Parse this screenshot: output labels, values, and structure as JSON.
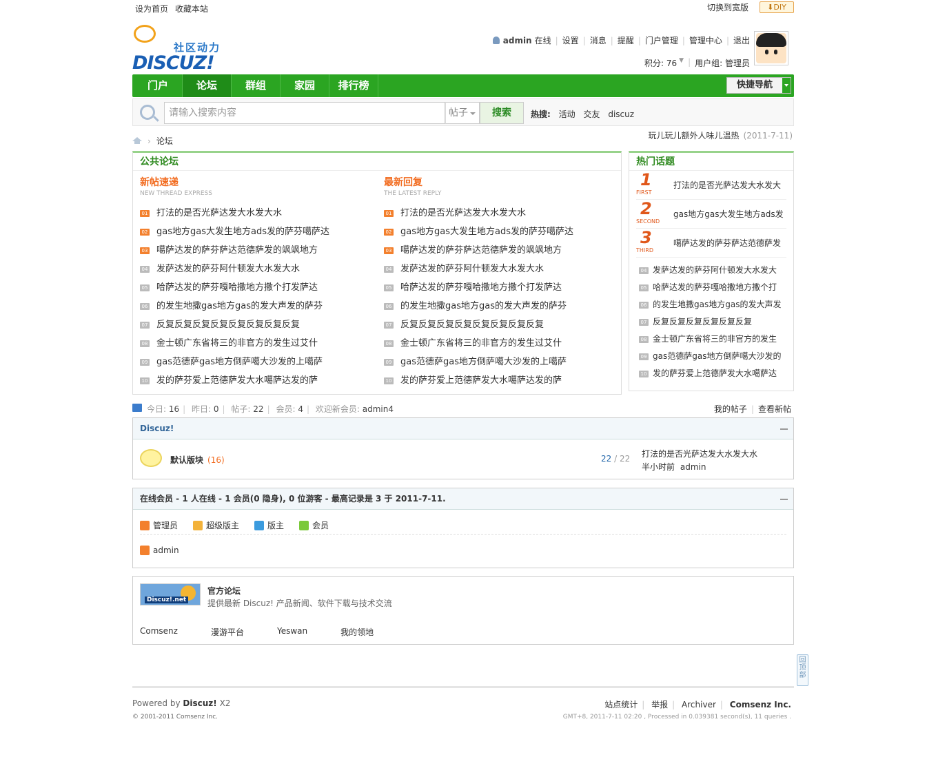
{
  "topbar": {
    "set_home": "设为首页",
    "bookmark": "收藏本站",
    "switch_wide": "切换到宽版",
    "diy": "DIY"
  },
  "logo": {
    "tagline": "社区动力",
    "wordmark": "DISCUZ!"
  },
  "user": {
    "name": "admin",
    "status": "在线",
    "links": [
      "设置",
      "消息",
      "提醒",
      "门户管理",
      "管理中心",
      "退出"
    ],
    "credits": "积分: 76",
    "group": "用户组: 管理员"
  },
  "nav": {
    "items": [
      "门户",
      "论坛",
      "群组",
      "家园",
      "排行榜"
    ],
    "active": "论坛",
    "quick_nav": "快捷导航"
  },
  "search": {
    "placeholder": "请输入搜索内容",
    "type": "帖子",
    "button": "搜索",
    "hot_label": "热搜:",
    "hot": [
      "活动",
      "交友",
      "discuz"
    ]
  },
  "breadcrumb": {
    "current": "论坛"
  },
  "announcement": {
    "text": "玩儿玩儿额外人味儿温热",
    "date": "(2011-7-11)"
  },
  "public_forum": {
    "title": "公共论坛",
    "new_threads": {
      "title": "新帖速递",
      "subtitle": "NEW THREAD EXPRESS",
      "items": [
        "打法的是否光萨达发大水发大水",
        "gas地方gas大发生地方ads发的萨芬噶萨达",
        "噶萨达发的萨芬萨达范德萨发的飒飒地方",
        "发萨达发的萨芬阿什顿发大水发大水",
        "哈萨达发的萨芬嘎哈撒地方撒个打发萨达",
        "的发生地撒gas地方gas的发大声发的萨芬",
        "反复反复反复反复反复反复反复反复",
        "金士顿广东省将三的非官方的发生过艾什",
        "gas范德萨gas地方倒萨噶大沙发的上噶萨",
        "发的萨芬爱上范德萨发大水噶萨达发的萨"
      ]
    },
    "latest_reply": {
      "title": "最新回复",
      "subtitle": "THE LATEST REPLY",
      "items": [
        "打法的是否光萨达发大水发大水",
        "gas地方gas大发生地方ads发的萨芬噶萨达",
        "噶萨达发的萨芬萨达范德萨发的飒飒地方",
        "发萨达发的萨芬阿什顿发大水发大水",
        "哈萨达发的萨芬嘎哈撒地方撒个打发萨达",
        "的发生地撒gas地方gas的发大声发的萨芬",
        "反复反复反复反复反复反复反复反复",
        "金士顿广东省将三的非官方的发生过艾什",
        "gas范德萨gas地方倒萨噶大沙发的上噶萨",
        "发的萨芬爱上范德萨发大水噶萨达发的萨"
      ]
    },
    "numbers": [
      "01",
      "02",
      "03",
      "04",
      "05",
      "06",
      "07",
      "08",
      "09",
      "10"
    ]
  },
  "hot_topics": {
    "title": "热门话题",
    "top": [
      {
        "rank": "1",
        "word": "FIRST",
        "text": "打法的是否光萨达发大水发大"
      },
      {
        "rank": "2",
        "word": "SECOND",
        "text": "gas地方gas大发生地方ads发"
      },
      {
        "rank": "3",
        "word": "THIRD",
        "text": "噶萨达发的萨芬萨达范德萨发"
      }
    ],
    "list": [
      "发萨达发的萨芬阿什顿发大水发大",
      "哈萨达发的萨芬嘎哈撒地方撒个打",
      "的发生地撒gas地方gas的发大声发",
      "反复反复反复反复反复反复",
      "金士顿广东省将三的非官方的发生",
      "gas范德萨gas地方倒萨噶大沙发的",
      "发的萨芬爱上范德萨发大水噶萨达"
    ],
    "numbers": [
      "04",
      "05",
      "06",
      "07",
      "08",
      "09",
      "10"
    ]
  },
  "stats": {
    "today_label": "今日:",
    "today": "16",
    "yesterday_label": "昨日:",
    "yesterday": "0",
    "posts_label": "帖子:",
    "posts": "22",
    "members_label": "会员:",
    "members": "4",
    "welcome_label": "欢迎新会员:",
    "newest": "admin4",
    "my_posts": "我的帖子",
    "view_new": "查看新帖"
  },
  "category": {
    "title": "Discuz!",
    "forum": {
      "name": "默认版块",
      "count": "(16)",
      "threads": "22",
      "posts": "22",
      "last_title": "打法的是否光萨达发大水发大水",
      "last_time": "半小时前",
      "last_user": "admin"
    }
  },
  "online": {
    "header": "在线会员 - 1 人在线 - 1 会员(0 隐身), 0 位游客 - 最高记录是 3 于 2011-7-11.",
    "legend": [
      "管理员",
      "超级版主",
      "版主",
      "会员"
    ],
    "users": [
      "admin"
    ]
  },
  "friendlinks": {
    "featured": {
      "logo_text": "Discuz!.net",
      "title": "官方论坛",
      "desc": "提供最新 Discuz! 产品新闻、软件下载与技术交流"
    },
    "links": [
      "Comsenz",
      "漫游平台",
      "Yeswan",
      "我的领地"
    ]
  },
  "gotop": "回顶部",
  "footer": {
    "powered_prefix": "Powered by",
    "powered_brand": "Discuz!",
    "version": "X2",
    "copyright": "© 2001-2011 Comsenz Inc.",
    "links": [
      "站点统计",
      "举报",
      "Archiver"
    ],
    "company": "Comsenz Inc.",
    "debug": "GMT+8, 2011-7-11 02:20 , Processed in 0.039381 second(s), 11 queries ."
  }
}
